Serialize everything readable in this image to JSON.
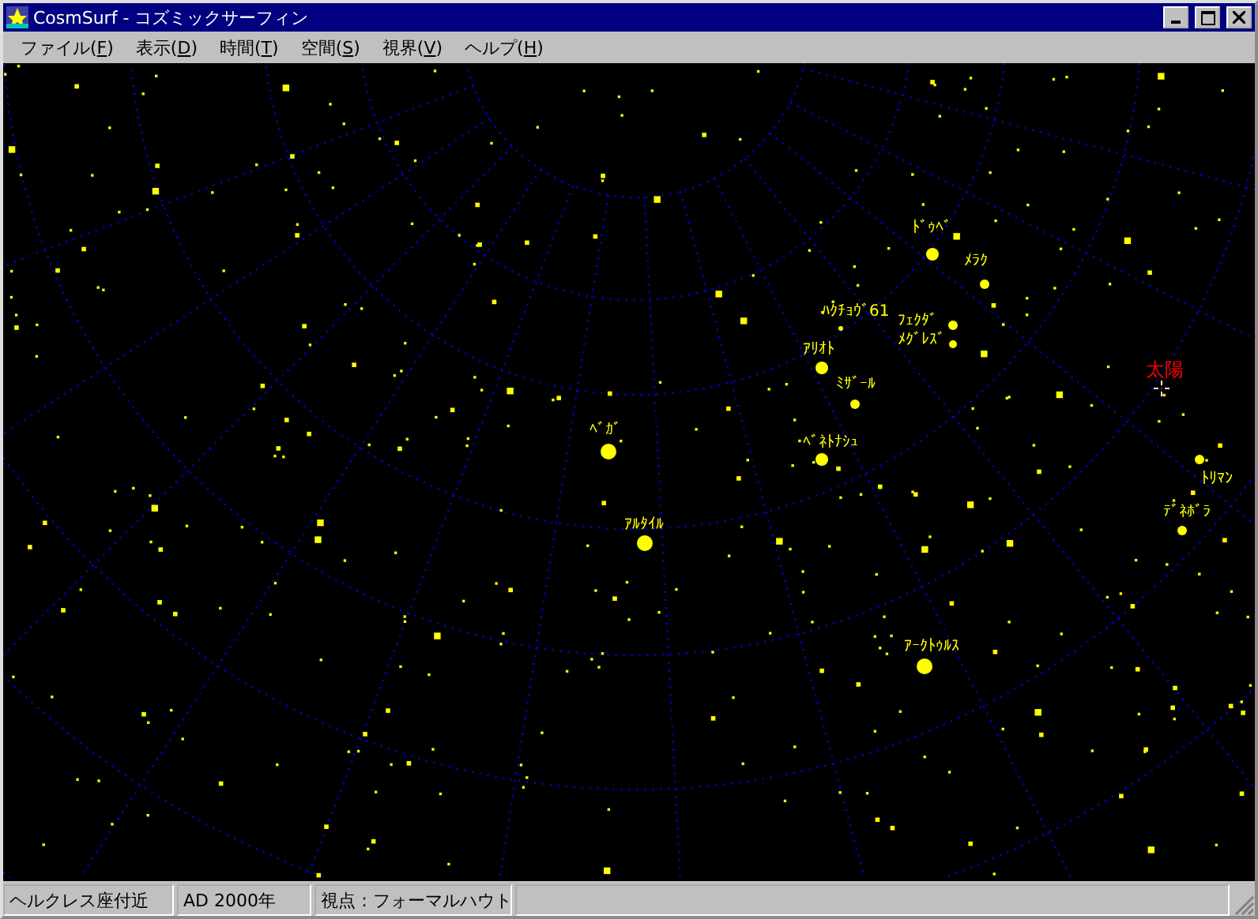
{
  "window": {
    "title": "CosmSurf - コズミックサーフィン"
  },
  "menu": [
    "ファイル(F)",
    "表示(D)",
    "時間(T)",
    "空間(S)",
    "視界(V)",
    "ヘルプ(H)"
  ],
  "star_map": {
    "labels": [
      {
        "name": "ﾄﾞｩﾍﾞ",
        "kind": "star"
      },
      {
        "name": "ﾒﾗｸ",
        "kind": "star"
      },
      {
        "name": "ﾊｸﾁｮｳﾞ61",
        "kind": "star"
      },
      {
        "name": "ﾌｪｸﾀﾞ",
        "kind": "star"
      },
      {
        "name": "ﾒｸﾞﾚｽﾞ",
        "kind": "star"
      },
      {
        "name": "ｱﾘｵﾄ",
        "kind": "star"
      },
      {
        "name": "太陽",
        "kind": "sun"
      },
      {
        "name": "ﾐｻﾞｰﾙ",
        "kind": "star"
      },
      {
        "name": "ﾍﾞｶﾞ",
        "kind": "star"
      },
      {
        "name": "ﾍﾞﾈﾄﾅｼｭ",
        "kind": "star"
      },
      {
        "name": "ﾄﾘﾏﾝ",
        "kind": "star"
      },
      {
        "name": "ﾃﾞﾈﾎﾞﾗ",
        "kind": "star"
      },
      {
        "name": "ｱﾙﾀｲﾙ",
        "kind": "star"
      },
      {
        "name": "ｱｰｸﾄｩﾙｽ",
        "kind": "star"
      }
    ]
  },
  "status_bar": [
    "ヘルクレス座付近",
    "AD 2000年",
    "視点：フォーマルハウト"
  ]
}
